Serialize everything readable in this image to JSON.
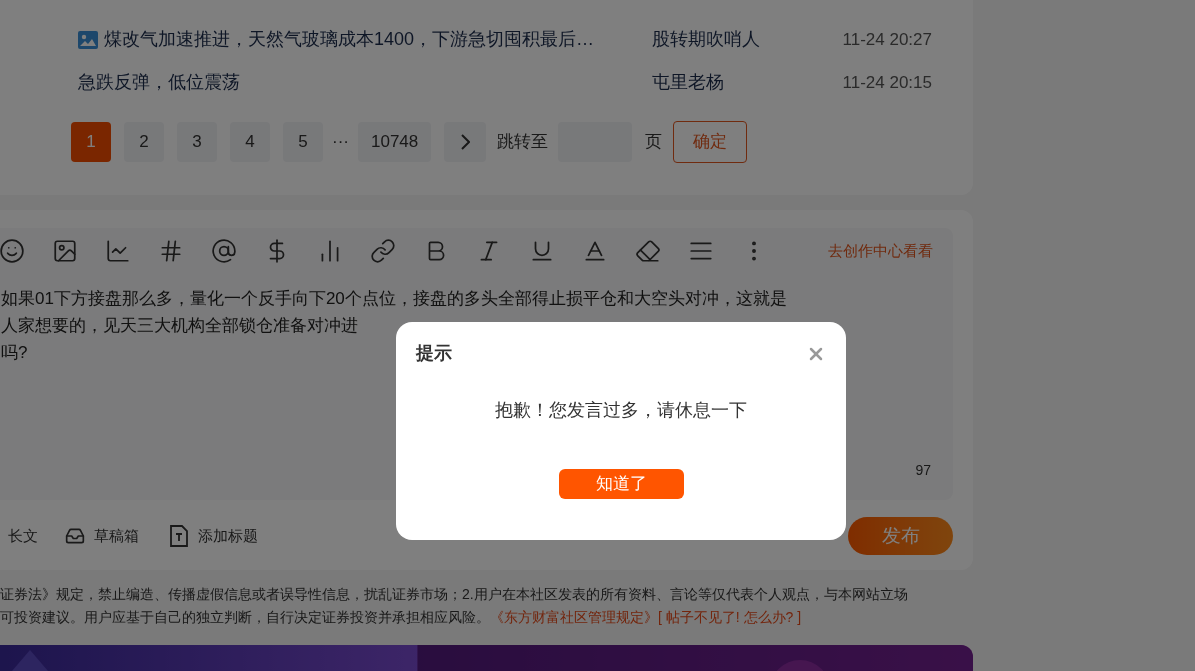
{
  "posts": [
    {
      "title": "煤改气加速推进，天然气玻璃成本1400，下游急切囤积最后…",
      "has_image": true,
      "author": "股转期吹哨人",
      "time": "11-24 20:27"
    },
    {
      "title": "急跌反弹，低位震荡",
      "has_image": false,
      "author": "屯里老杨",
      "time": "11-24 20:15"
    }
  ],
  "pagination": {
    "pages": [
      {
        "label": "1",
        "selected": true
      },
      {
        "label": "2",
        "selected": false
      },
      {
        "label": "3",
        "selected": false
      },
      {
        "label": "4",
        "selected": false
      },
      {
        "label": "5",
        "selected": false
      }
    ],
    "ellipsis": "···",
    "last_page": "10748",
    "jump_label": "跳转至",
    "page_unit": "页",
    "confirm": "确定"
  },
  "editor": {
    "creation_link": "去创作中心看看",
    "text_lines": [
      "如果01下方接盘那么多，量化一个反手向下20个点位，接盘的多头全部得止损平仓和大空头对冲，这就是",
      "人家想要的，见天三大机构全部锁仓准备对冲进",
      "吗?"
    ],
    "char_count": "97"
  },
  "actions": [
    {
      "label": "长文"
    },
    {
      "label": "草稿箱"
    },
    {
      "label": "添加标题"
    }
  ],
  "publish": "发布",
  "disclaimer": {
    "line1": "证券法》规定，禁止编造、传播虚假信息或者误导性信息，扰乱证券市场；2.用户在本社区发表的所有资料、言论等仅代表个人观点，与本网站立场",
    "line2": "可投资建议。用户应基于自己的独立判断，自行决定证券投资并承担相应风险。",
    "rules_link": "《东方财富社区管理规定》",
    "help_link": "[ 帖子不见了! 怎么办? ]"
  },
  "dialog": {
    "title": "提示",
    "message": "抱歉！您发言过多，请休息一下",
    "button": "知道了"
  }
}
